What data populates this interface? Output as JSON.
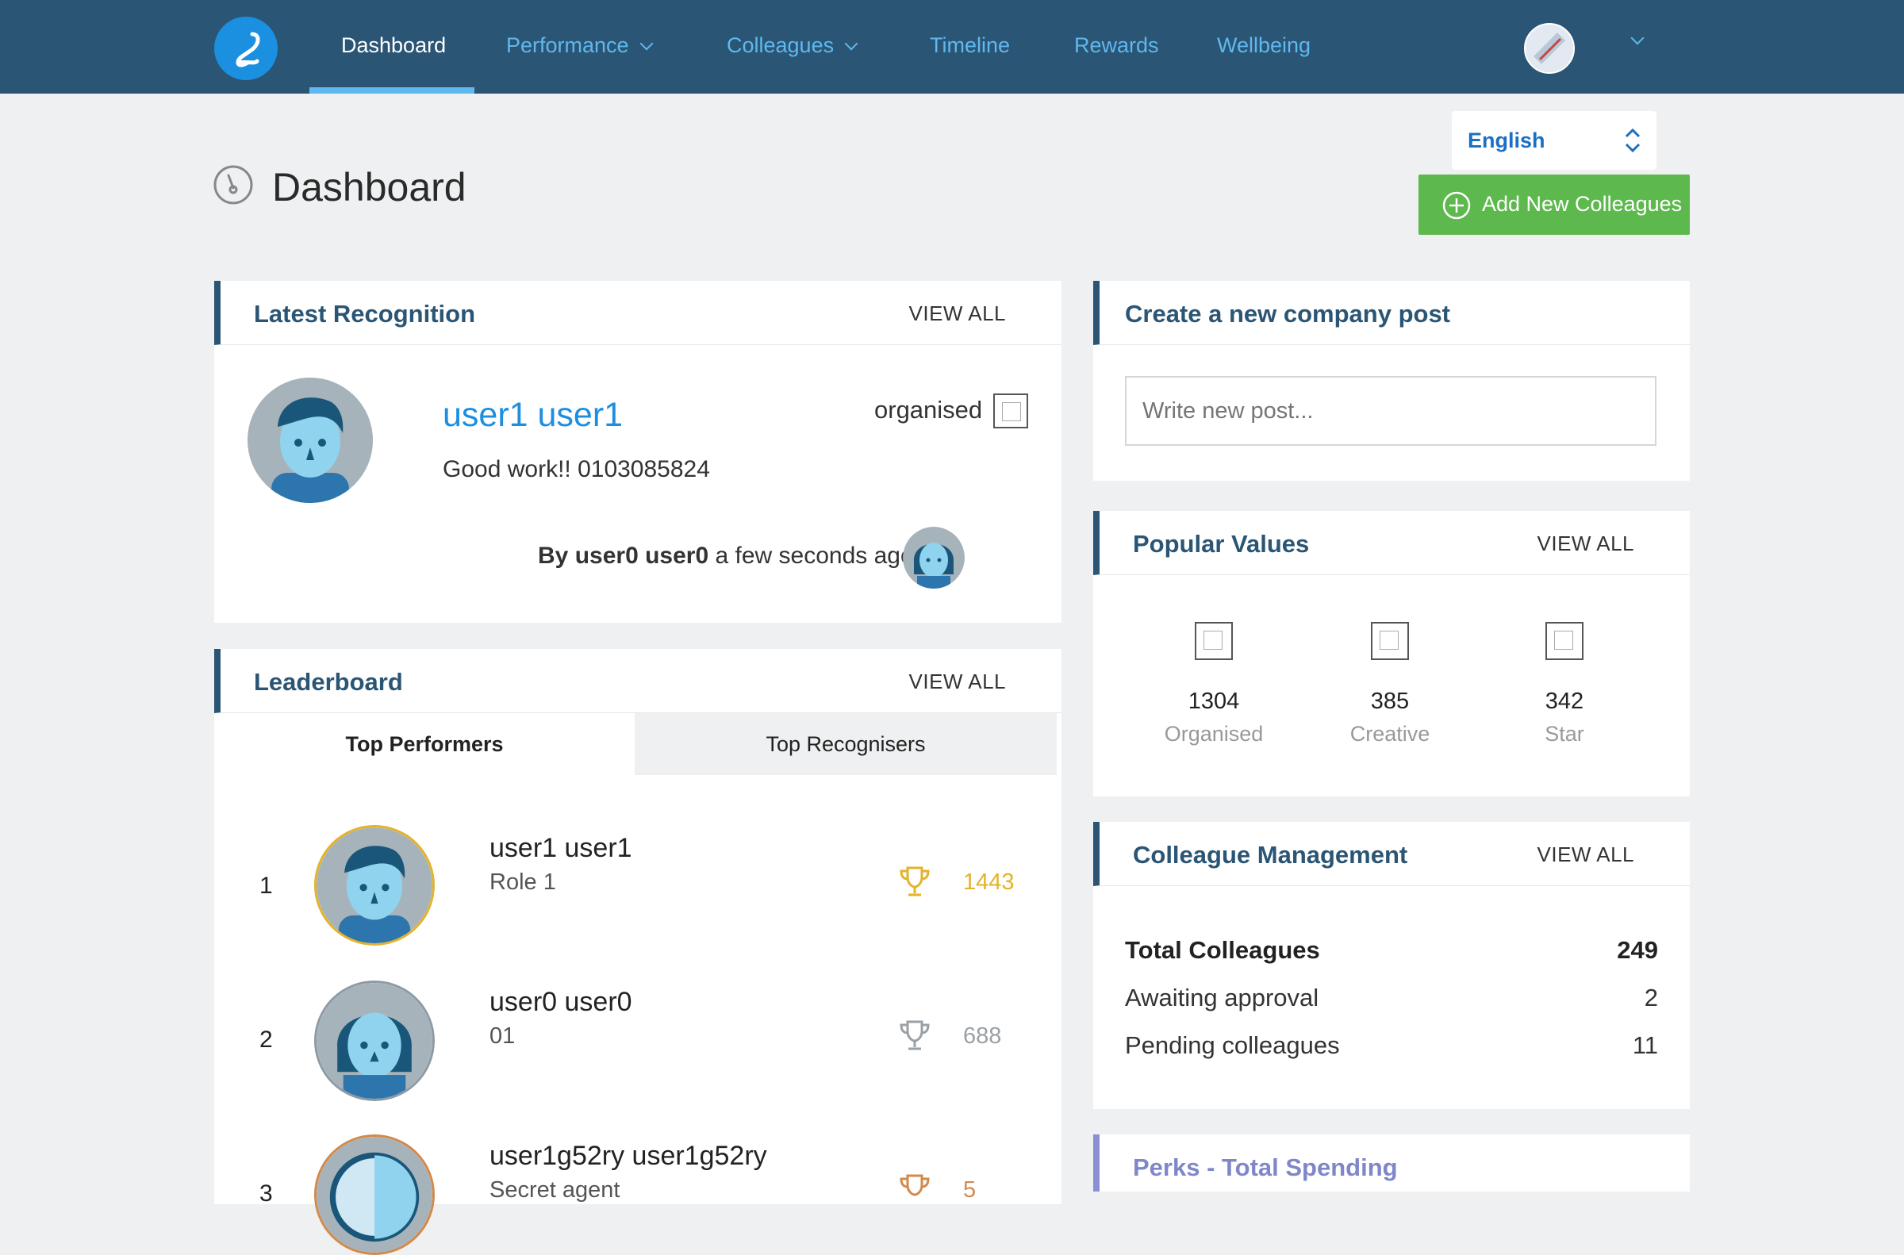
{
  "nav": {
    "items": [
      {
        "label": "Dashboard",
        "active": true
      },
      {
        "label": "Performance",
        "dropdown": true
      },
      {
        "label": "Colleagues",
        "dropdown": true
      },
      {
        "label": "Timeline"
      },
      {
        "label": "Rewards"
      },
      {
        "label": "Wellbeing"
      }
    ],
    "logo_icon": "app-logo-icon"
  },
  "page": {
    "title": "Dashboard",
    "icon": "speedometer-icon",
    "language": "English",
    "add_button": "Add New Colleagues"
  },
  "latest_recognition": {
    "title": "Latest Recognition",
    "view_all": "VIEW ALL",
    "recipient": "user1 user1",
    "value": "organised",
    "message": "Good work!! 0103085824",
    "by_label": "By",
    "by_user": "user0 user0",
    "time": "a few seconds ago"
  },
  "leaderboard": {
    "title": "Leaderboard",
    "view_all": "VIEW ALL",
    "tabs": [
      "Top Performers",
      "Top Recognisers"
    ],
    "rows": [
      {
        "rank": "1",
        "name": "user1 user1",
        "role": "Role 1",
        "score": "1443"
      },
      {
        "rank": "2",
        "name": "user0 user0",
        "role": "01",
        "score": "688"
      },
      {
        "rank": "3",
        "name": "user1g52ry user1g52ry",
        "role": "Secret agent",
        "score": "5"
      }
    ]
  },
  "company_post": {
    "title": "Create a new company post",
    "placeholder": "Write new post..."
  },
  "popular_values": {
    "title": "Popular Values",
    "view_all": "VIEW ALL",
    "values": [
      {
        "count": "1304",
        "label": "Organised"
      },
      {
        "count": "385",
        "label": "Creative"
      },
      {
        "count": "342",
        "label": "Star"
      }
    ]
  },
  "colleague_management": {
    "title": "Colleague Management",
    "view_all": "VIEW ALL",
    "total_label": "Total Colleagues",
    "total_value": "249",
    "awaiting_label": "Awaiting approval",
    "awaiting_value": "2",
    "pending_label": "Pending colleagues",
    "pending_value": "11"
  },
  "perks": {
    "title": "Perks - Total Spending"
  },
  "colors": {
    "nav_bg": "#2b5574",
    "accent": "#5fb8ee",
    "green": "#5db84d",
    "gold": "#e3b32a"
  }
}
